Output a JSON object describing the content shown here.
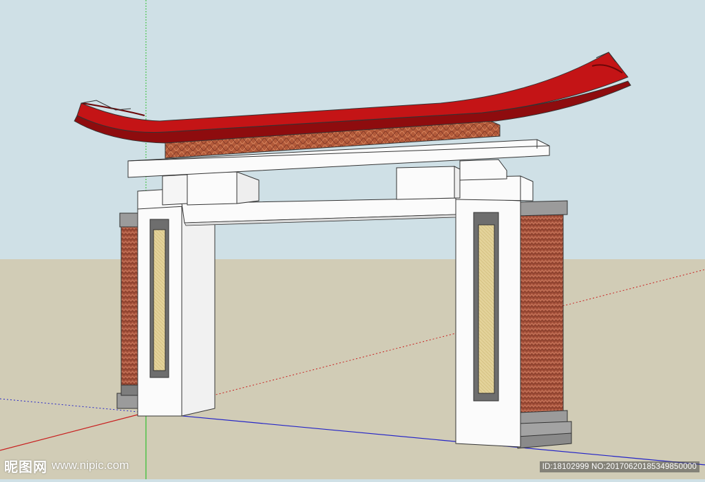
{
  "scene": {
    "subject": "gate-archway-model",
    "colors": {
      "sky": "#cfe0e6",
      "ground": "#d1ccb6",
      "roof_red": "#c41416",
      "roof_dark": "#8e0c0e",
      "brick": "#a5503a",
      "stone_white": "#fbfbfb",
      "stone_grey": "#9a9a9a",
      "panel_cream": "#e3d29a",
      "axis_green": "#2fbf2f",
      "axis_red": "#c81e1e",
      "axis_blue": "#2222c8"
    },
    "icons": [
      "green-axis-icon",
      "red-axis-icon",
      "blue-axis-icon"
    ]
  },
  "watermark": {
    "logo_text": "昵图网",
    "site": "www.nipic.com",
    "id_line": "ID:18102999 NO:20170620185349850000"
  }
}
